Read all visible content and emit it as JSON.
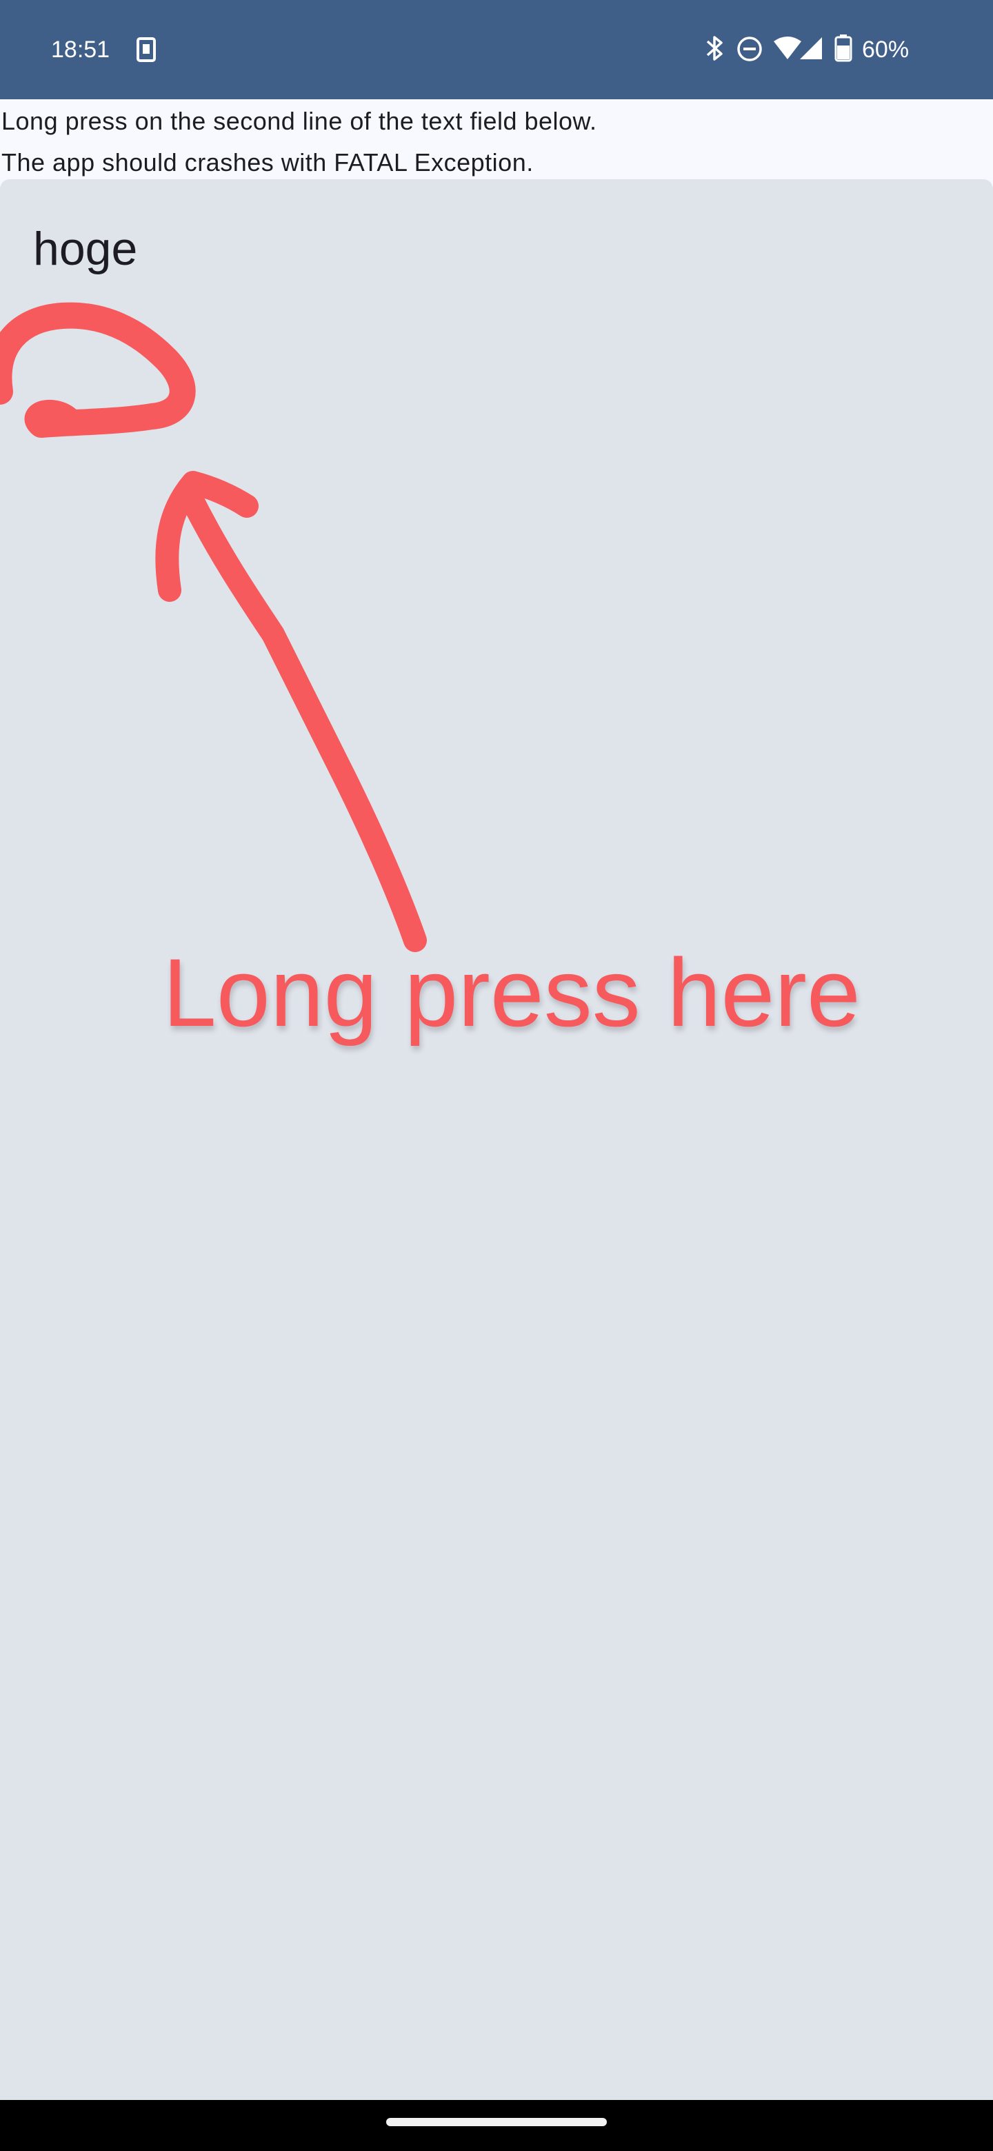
{
  "status_bar": {
    "time": "18:51",
    "battery": "60%",
    "icons": [
      "notification-app-icon",
      "bluetooth-icon",
      "do-not-disturb-icon",
      "wifi-icon",
      "cell-signal-icon",
      "battery-icon"
    ],
    "background": "#3f5f89"
  },
  "instructions": {
    "line1": "Long press on the second line of the text field below.",
    "line2": "The app should crashes with FATAL Exception."
  },
  "text_field": {
    "value": "hoge",
    "background": "#dfe3ea"
  },
  "annotation": {
    "label": "Long press here",
    "color": "#f75a5d"
  }
}
